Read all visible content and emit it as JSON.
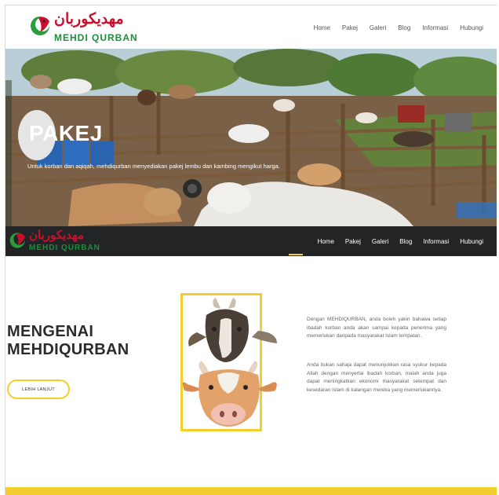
{
  "brand": {
    "arabic": "مهديكوربان",
    "latin": "MEHDI QURBAN"
  },
  "nav": {
    "items": [
      "Home",
      "Pakej",
      "Galeri",
      "Blog",
      "Informasi",
      "Hubungi"
    ],
    "active": "Pakej"
  },
  "hero": {
    "title": "PAKEJ",
    "subtitle": "Untuk korban dan aqiqah, mehdiqurban menyediakan pakej lembu dan kambing mengikut harga."
  },
  "sticky_nav": {
    "items": [
      "Home",
      "Pakej",
      "Galeri",
      "Blog",
      "Informasi",
      "Hubungi"
    ],
    "active": "Home"
  },
  "about": {
    "title_line1": "MENGENAI",
    "title_line2": "MEHDIQURBAN",
    "button_label": "LEBIH LANJUT",
    "paragraph1": "Dengan MEHDIQURBAN, anda boleh yakin bahawa setiap ibadah korban anda akan sampai kepada penerima yang memerlukan daripada masyarakat Islam tempatan.",
    "paragraph2": "Anda bukan sahaja dapat menunjukkan rasa syukur kepada Allah dengan menyertai ibadah korban, malah anda juga dapat meningkatkan ekonomi masyarakat setempat dan kesedaran Islam di kalangan mereka yang memerlukannya."
  },
  "colors": {
    "accent": "#f2cf2f",
    "dark_header": "#222426",
    "brand_red": "#c8102e",
    "brand_green": "#1a8f3a"
  }
}
